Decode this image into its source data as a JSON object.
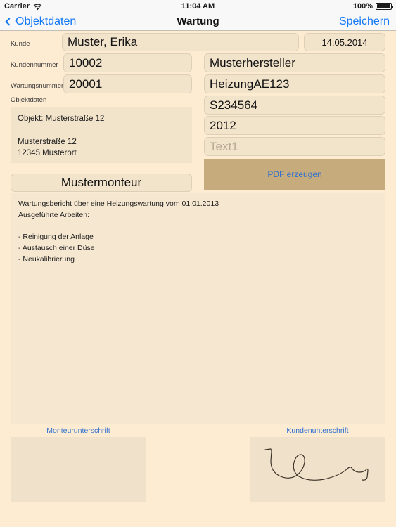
{
  "status_bar": {
    "carrier": "Carrier",
    "wifi_icon": "wifi-icon",
    "time": "11:04 AM",
    "battery_percent": "100%",
    "battery_icon": "battery-full-icon"
  },
  "nav_bar": {
    "back_icon": "chevron-left-icon",
    "back_label": "Objektdaten",
    "title": "Wartung",
    "save_label": "Speichern"
  },
  "form": {
    "labels": {
      "kunde": "Kunde",
      "kundennummer": "Kundennummer",
      "wartungsnummer": "Wartungsnummer",
      "objektdaten": "Objektdaten"
    },
    "kunde_value": "Muster, Erika",
    "date_value": "14.05.2014",
    "kundennummer_value": "10002",
    "wartungsnummer_value": "20001",
    "hersteller_value": "Musterhersteller",
    "anlage_value": "HeizungAE123",
    "seriennummer_value": "S234564",
    "baujahr_value": "2012",
    "text1_placeholder": "Text1",
    "text1_value": "",
    "objektdaten_text": "Objekt: Musterstraße 12\n\nMusterstraße 12\n12345 Musterort",
    "monteur_value": "Mustermonteur",
    "pdf_button_label": "PDF erzeugen",
    "report_text": "Wartungsbericht über eine Heizungswartung vom 01.01.2013\nAusgeführte Arbeiten:\n\n- Reinigung der Anlage\n- Austausch einer Düse\n- Neukalibrierung"
  },
  "signatures": {
    "monteur_label": "Monteurunterschrift",
    "kunde_label": "Kundenunterschrift",
    "monteur_signature_present": false,
    "kunde_signature_present": true
  },
  "colors": {
    "page_background": "#fdebd2",
    "field_background": "#f2e3cb",
    "field_border": "#ded0b8",
    "accent_blue": "#1077f5",
    "link_blue": "#2f6fd0",
    "pdf_button_background": "#c6ab7d",
    "chrome_background": "#f8f8f8",
    "text_primary": "#111111",
    "placeholder": "#b6aa95"
  }
}
